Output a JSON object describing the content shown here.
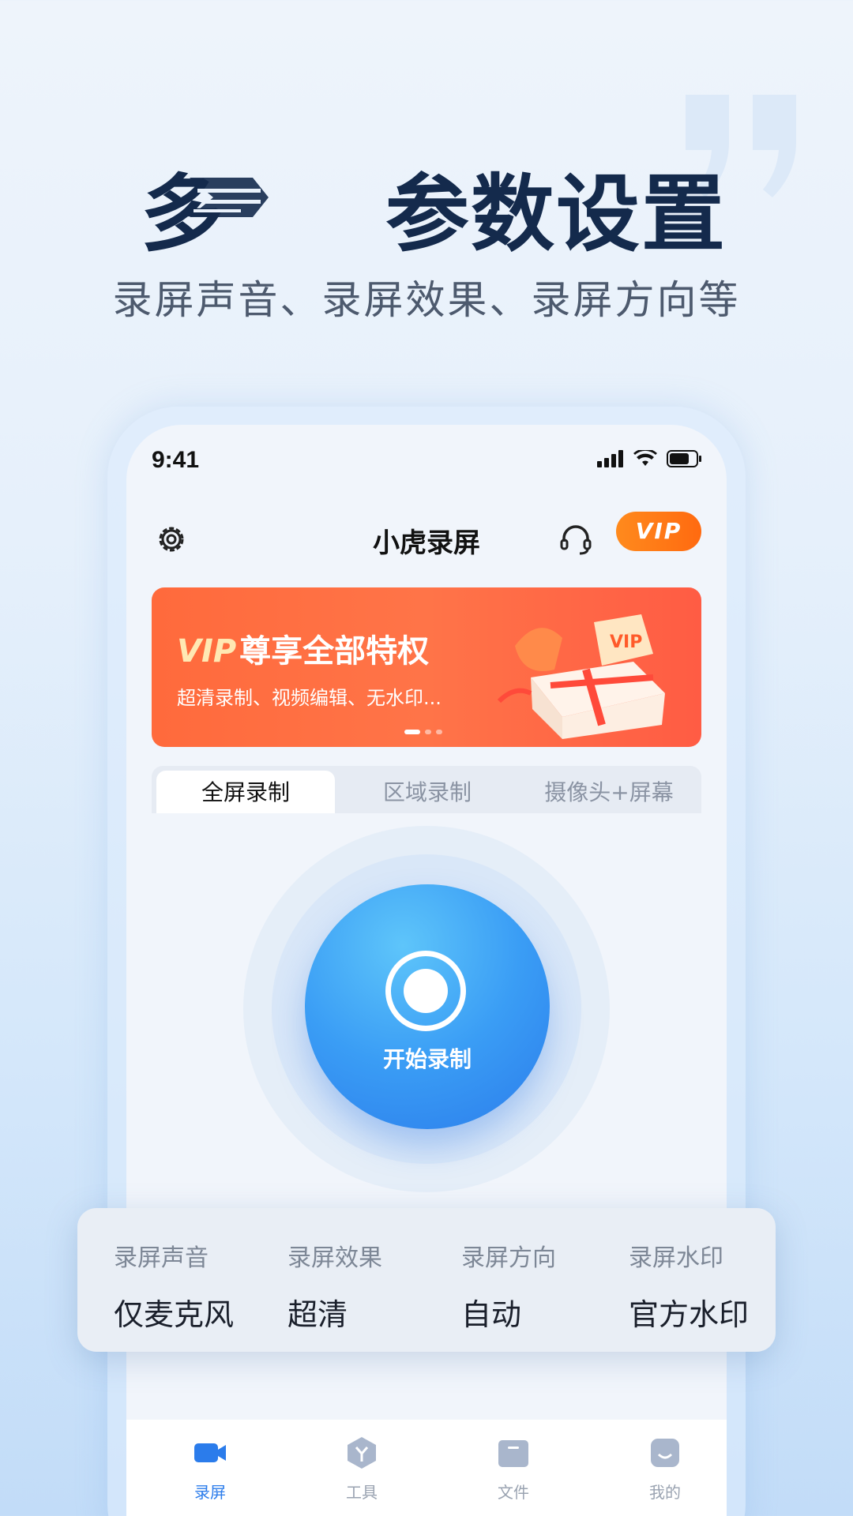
{
  "hero": {
    "title_left": "多",
    "title_right": "参数设置",
    "subtitle": "录屏声音、录屏效果、录屏方向等"
  },
  "status_bar": {
    "time": "9:41"
  },
  "app": {
    "title": "小虎录屏",
    "vip_button": "VIP"
  },
  "banner": {
    "title_vip": "VIP",
    "title_rest": "尊享全部特权",
    "subtitle": "超清录制、视频编辑、无水印..."
  },
  "tabs": [
    {
      "label": "全屏录制"
    },
    {
      "label": "区域录制"
    },
    {
      "label": "摄像头+屏幕"
    }
  ],
  "record_button": {
    "label": "开始录制"
  },
  "settings": [
    {
      "key": "录屏声音",
      "value": "仅麦克风"
    },
    {
      "key": "录屏效果",
      "value": "超清"
    },
    {
      "key": "录屏方向",
      "value": "自动"
    },
    {
      "key": "录屏水印",
      "value": "官方水印"
    }
  ],
  "tabbar": [
    {
      "label": "录屏",
      "icon": "video-camera-icon"
    },
    {
      "label": "工具",
      "icon": "tools-icon"
    },
    {
      "label": "文件",
      "icon": "folder-icon"
    },
    {
      "label": "我的",
      "icon": "profile-icon"
    }
  ],
  "colors": {
    "accent_blue": "#2b7ceb",
    "vip_orange": "#ff7a18",
    "banner_red": "#ff6a3c",
    "title_navy": "#142a4c"
  }
}
